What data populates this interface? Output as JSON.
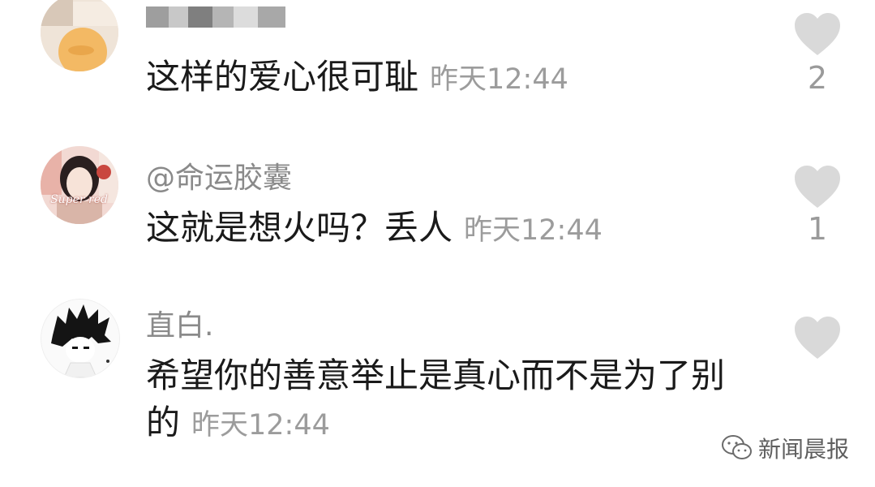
{
  "comments": [
    {
      "username": "",
      "text": "这样的爱心很可耻",
      "time": "昨天12:44",
      "likes": "2",
      "avatar": "blurred-avatar"
    },
    {
      "username": "@命运胶囊",
      "text": "这就是想火吗？丢人",
      "time": "昨天12:44",
      "likes": "1",
      "avatar": "photo-avatar",
      "avatar_caption": "Super red"
    },
    {
      "username": "直白.",
      "text_line1": "希望你的善意举止是真心而不是为了别",
      "text_line2": "的",
      "time": "昨天12:44",
      "likes": "",
      "avatar": "anime-avatar"
    }
  ],
  "watermark": {
    "icon": "wechat-icon",
    "label": "新闻晨报"
  },
  "colors": {
    "heart": "#d9d9d9",
    "username": "#8a8a8a",
    "time": "#9c9c9c"
  }
}
